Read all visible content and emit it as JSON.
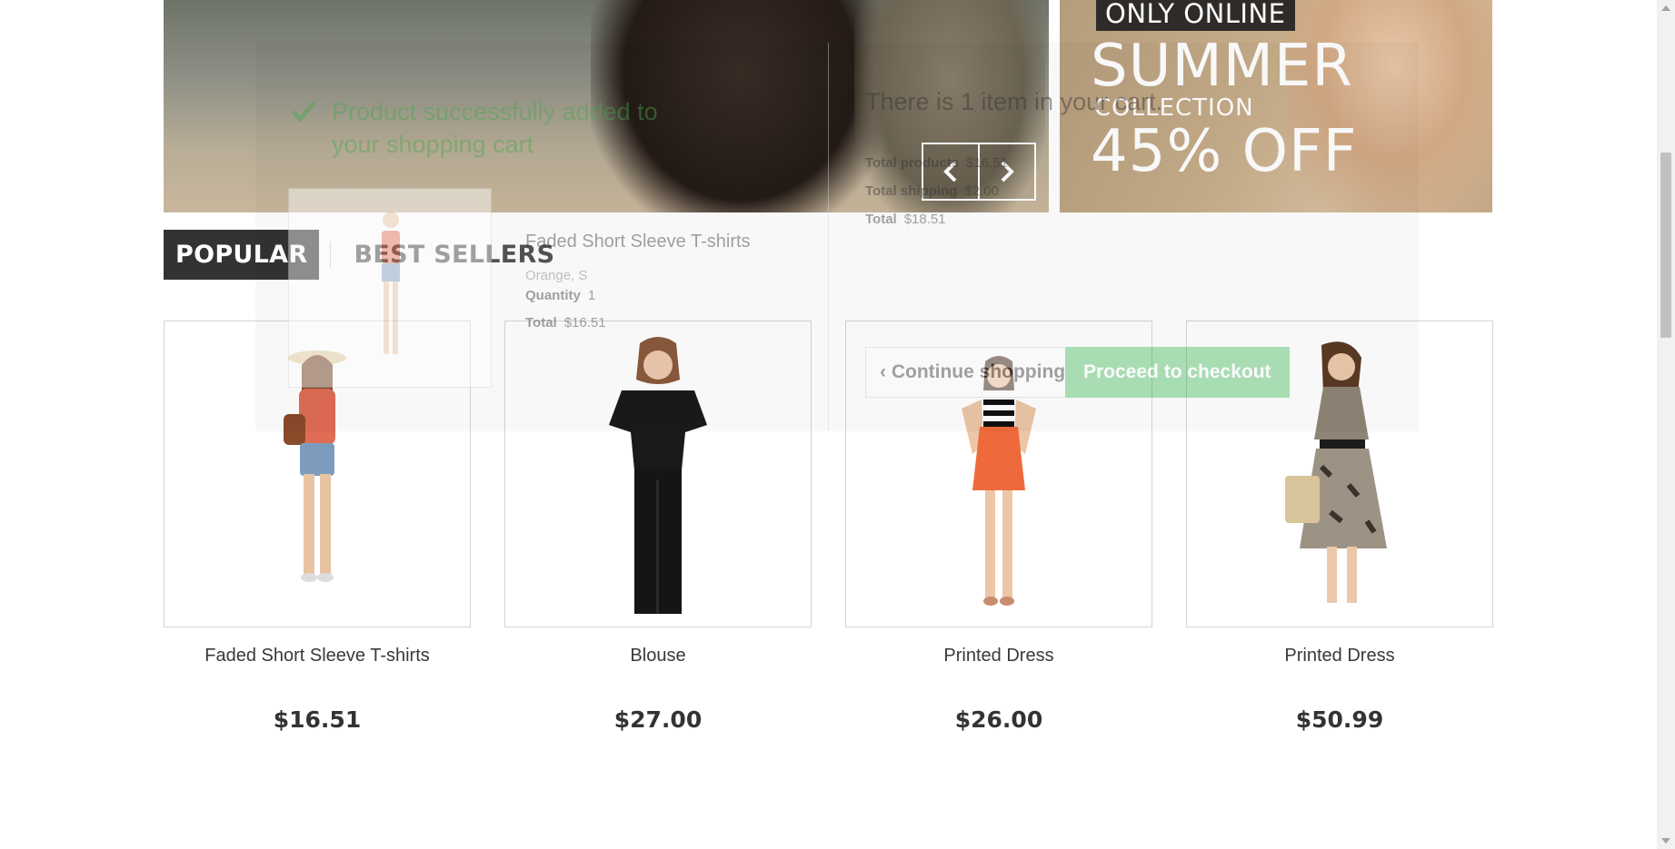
{
  "banner_main": {
    "slider_prev": "prev",
    "slider_next": "next"
  },
  "banner_side": {
    "badge": "ONLY ONLINE",
    "headline": "SUMMER",
    "subline": "COLLECTION",
    "discount": "45% OFF"
  },
  "tabs": [
    {
      "label": "POPULAR"
    },
    {
      "label": "BEST SELLERS"
    }
  ],
  "products": [
    {
      "name": "Faded Short Sleeve T-shirts",
      "price": "$16.51"
    },
    {
      "name": "Blouse",
      "price": "$27.00"
    },
    {
      "name": "Printed Dress",
      "price": "$26.00"
    },
    {
      "name": "Printed Dress",
      "price": "$50.99"
    }
  ],
  "cart_layer": {
    "success_message": "Product successfully added to your shopping cart",
    "product_name": "Faded Short Sleeve T-shirts",
    "attributes": "Orange, S",
    "quantity_label": "Quantity",
    "quantity_value": "1",
    "total_label": "Total",
    "total_value": "$16.51",
    "cart_count_text": "There is 1 item in your cart.",
    "total_products_label": "Total products",
    "total_products_value": "$16.51",
    "total_shipping_label": "Total shipping",
    "total_shipping_value": "$2.00",
    "grand_total_label": "Total",
    "grand_total_value": "$18.51",
    "continue_label": "Continue shopping",
    "checkout_label": "Proceed to checkout"
  },
  "colors": {
    "success": "#46a74e",
    "checkout_button": "#46b95c",
    "tab_active": "#333333"
  },
  "icons": [
    "chevron-left-icon",
    "chevron-right-icon",
    "check-icon",
    "close-icon"
  ]
}
